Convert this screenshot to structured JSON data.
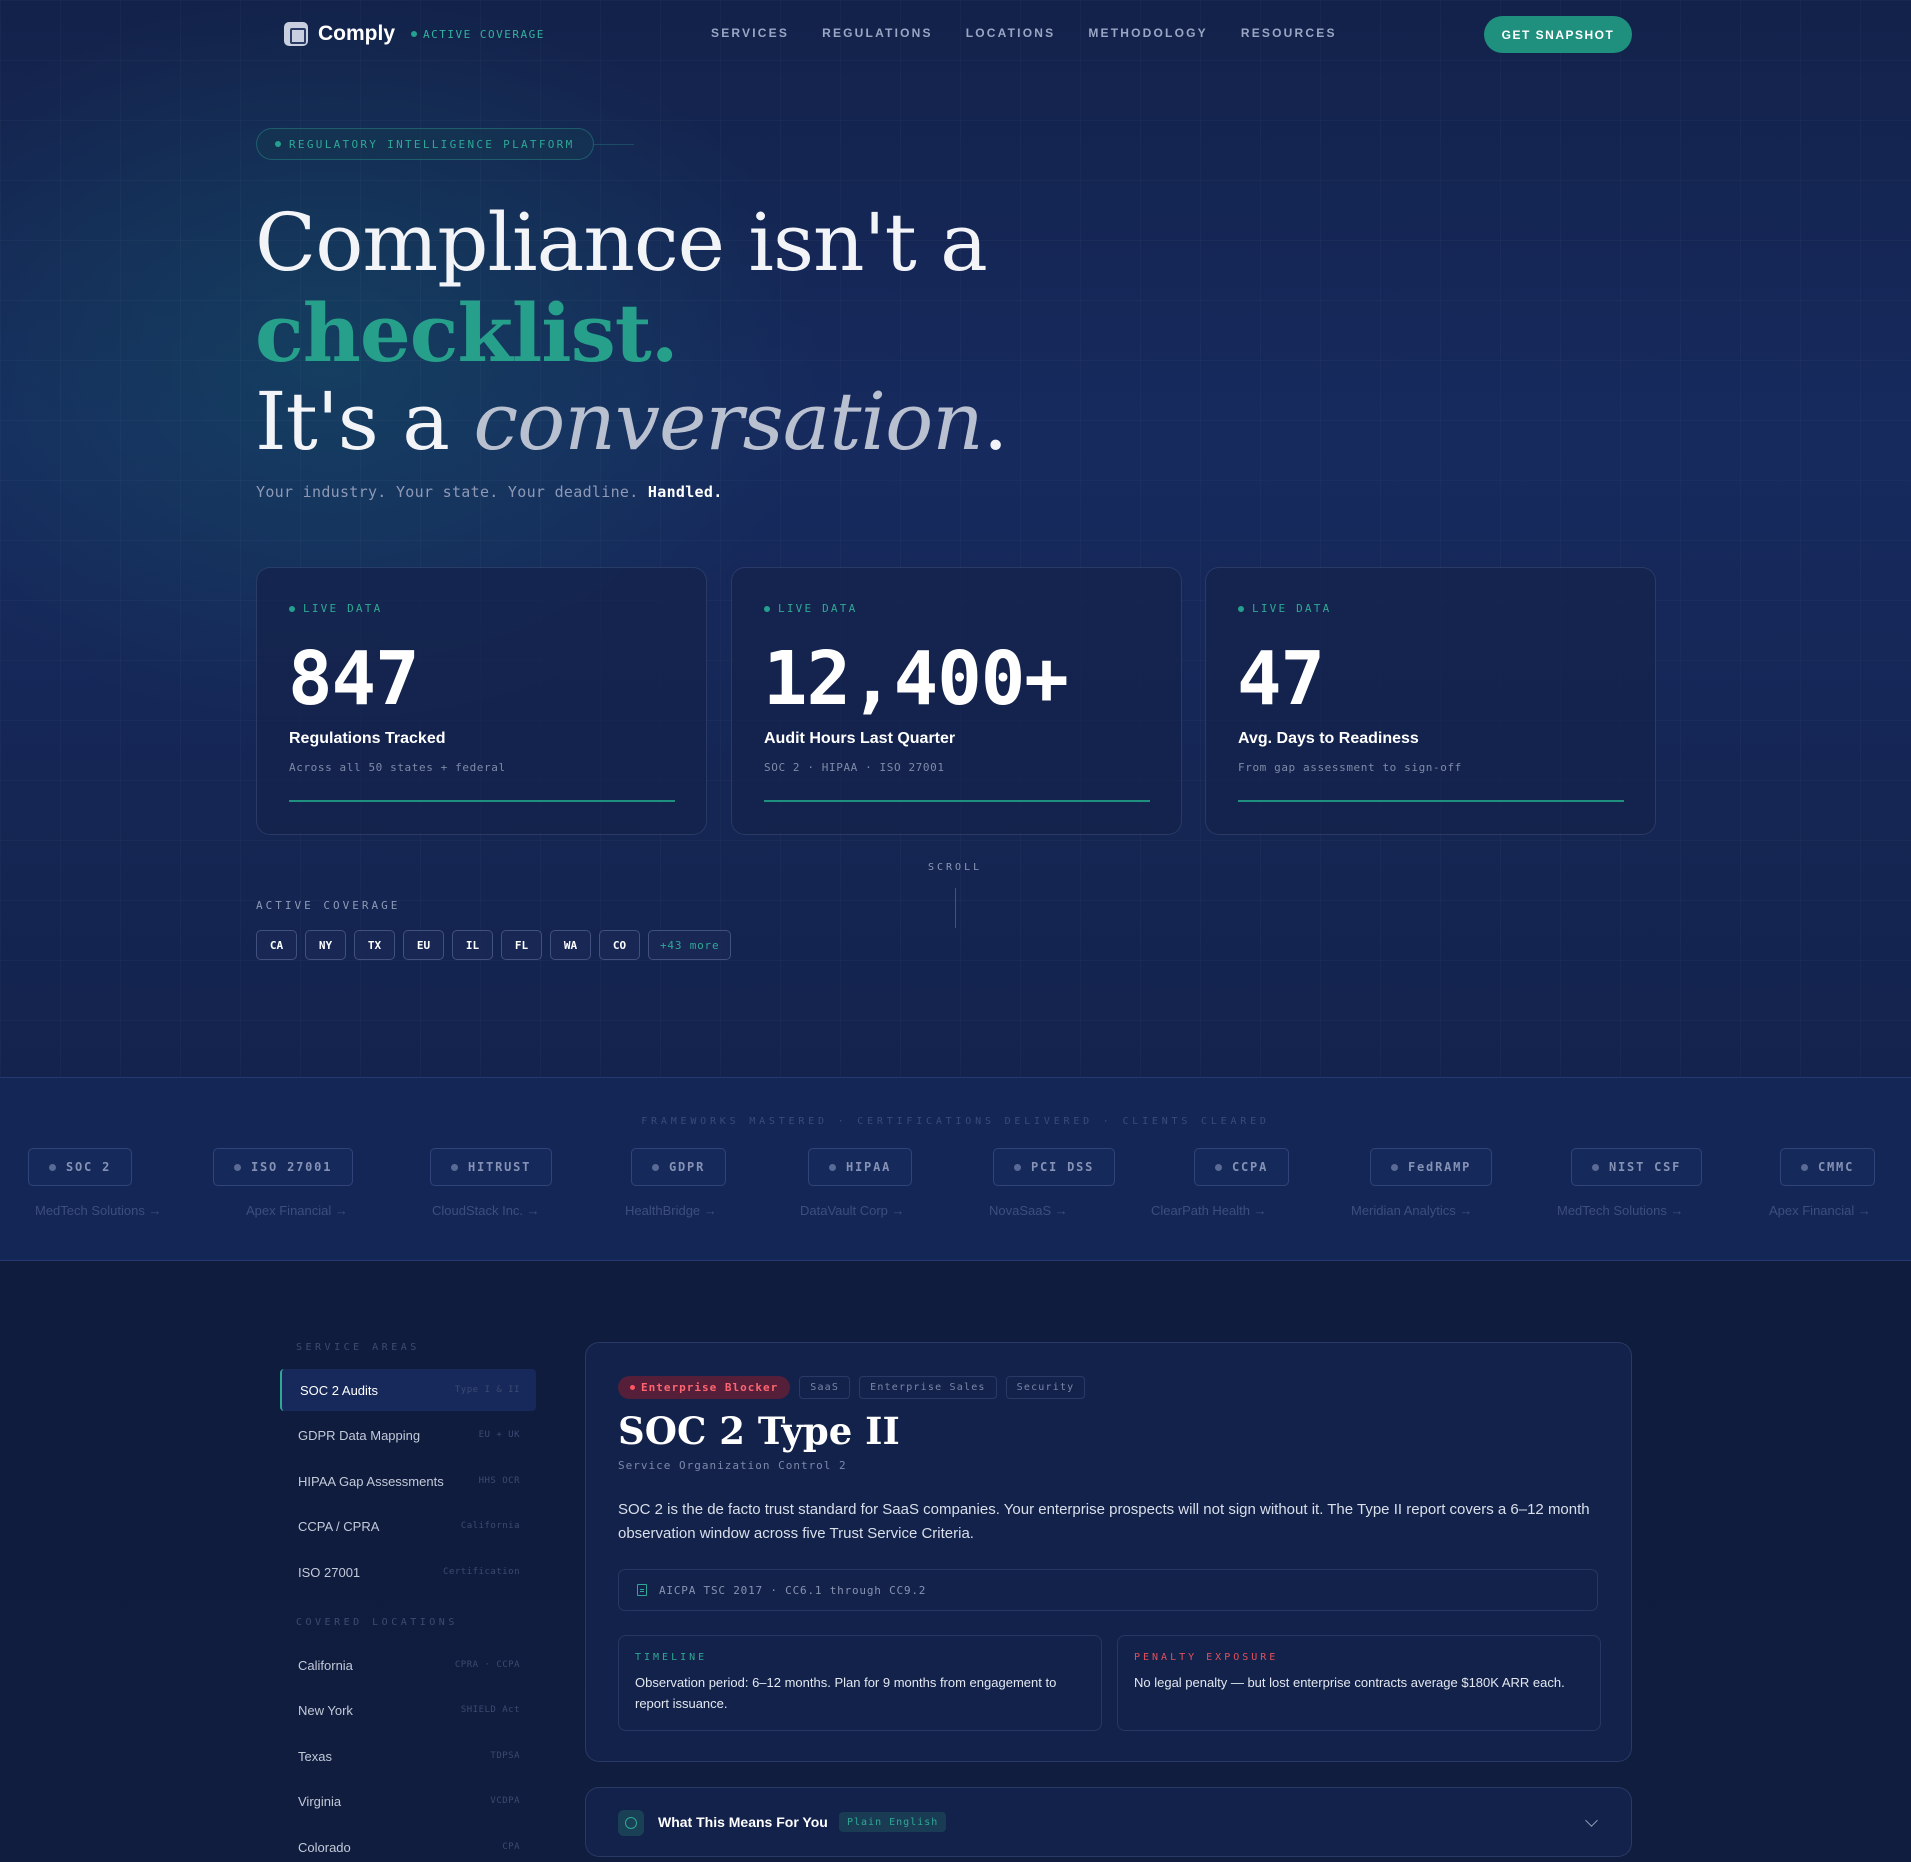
{
  "nav": {
    "brand": "Comply",
    "coverage": "ACTIVE COVERAGE",
    "links": [
      "SERVICES",
      "REGULATIONS",
      "LOCATIONS",
      "METHODOLOGY",
      "RESOURCES"
    ],
    "cta": "GET SNAPSHOT"
  },
  "hero": {
    "badge": "REGULATORY INTELLIGENCE PLATFORM",
    "line1": "Compliance isn't a",
    "line2": "checklist.",
    "line3_a": "It's a ",
    "line3_b": "conversation",
    "line3_c": ".",
    "tagline": "Your industry. Your state. Your deadline. ",
    "tagline_bold": "Handled."
  },
  "stats": [
    {
      "live": "LIVE DATA",
      "value": "847",
      "label": "Regulations Tracked",
      "sub": "Across all 50 states + federal"
    },
    {
      "live": "LIVE DATA",
      "value": "12,400+",
      "label": "Audit Hours Last Quarter",
      "sub": "SOC 2 · HIPAA · ISO 27001"
    },
    {
      "live": "LIVE DATA",
      "value": "47",
      "label": "Avg. Days to Readiness",
      "sub": "From gap assessment to sign-off"
    }
  ],
  "scroll": "SCROLL",
  "coverage": {
    "title": "ACTIVE COVERAGE",
    "chips": [
      "CA",
      "NY",
      "TX",
      "EU",
      "IL",
      "FL",
      "WA",
      "CO"
    ],
    "more": "+43 more"
  },
  "frameworks": {
    "title": "FRAMEWORKS MASTERED · CERTIFICATIONS DELIVERED · CLIENTS CLEARED",
    "items": [
      "SOC 2",
      "ISO 27001",
      "HITRUST",
      "GDPR",
      "HIPAA",
      "PCI DSS",
      "CCPA",
      "FedRAMP",
      "NIST CSF",
      "CMMC"
    ],
    "clients": [
      "MedTech Solutions →",
      "Apex Financial →",
      "CloudStack Inc. →",
      "HealthBridge →",
      "DataVault Corp →",
      "NovaSaaS →",
      "ClearPath Health →",
      "Meridian Analytics →",
      "MedTech Solutions →",
      "Apex Financial →"
    ]
  },
  "sidebar": {
    "services_head": "SERVICE AREAS",
    "services": [
      {
        "label": "SOC 2 Audits",
        "tag": "Type I & II"
      },
      {
        "label": "GDPR Data Mapping",
        "tag": "EU + UK"
      },
      {
        "label": "HIPAA Gap Assessments",
        "tag": "HHS OCR"
      },
      {
        "label": "CCPA / CPRA",
        "tag": "California"
      },
      {
        "label": "ISO 27001",
        "tag": "Certification"
      }
    ],
    "locations_head": "COVERED LOCATIONS",
    "locations": [
      {
        "label": "California",
        "tag": "CPRA · CCPA"
      },
      {
        "label": "New York",
        "tag": "SHIELD Act"
      },
      {
        "label": "Texas",
        "tag": "TDPSA"
      },
      {
        "label": "Virginia",
        "tag": "VCDPA"
      },
      {
        "label": "Colorado",
        "tag": "CPA"
      }
    ]
  },
  "panel": {
    "tag_primary": "Enterprise Blocker",
    "tags": [
      "SaaS",
      "Enterprise Sales",
      "Security"
    ],
    "title": "SOC 2 Type II",
    "subtitle": "Service Organization Control 2",
    "description": "SOC 2 is the de facto trust standard for SaaS companies. Your enterprise prospects will not sign without it. The Type II report covers a 6–12 month observation window across five Trust Service Criteria.",
    "reference": "AICPA TSC 2017 · CC6.1 through CC9.2",
    "timeline_head": "TIMELINE",
    "timeline": "Observation period: 6–12 months. Plan for 9 months from engagement to report issuance.",
    "penalty_head": "PENALTY EXPOSURE",
    "penalty": "No legal penalty — but lost enterprise contracts average $180K ARR each."
  },
  "accordion": {
    "title": "What This Means For You",
    "pill": "Plain English"
  },
  "colors": {
    "accent": "#1f8f7e",
    "accent_text": "#2fa894",
    "danger": "#ff5462",
    "bg": "#0f1b3a"
  }
}
